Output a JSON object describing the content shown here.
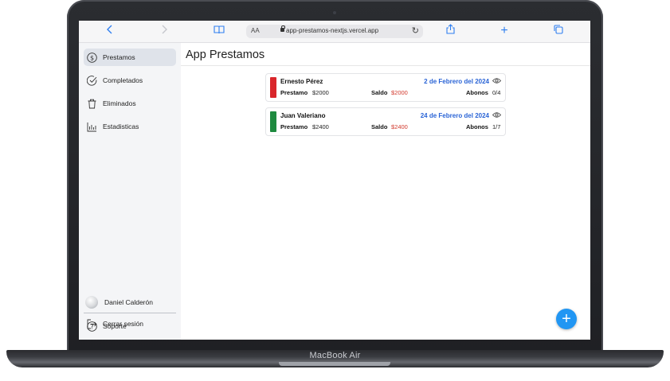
{
  "device": {
    "brand_label": "MacBook Air"
  },
  "browser": {
    "text_size_label": "AA",
    "url": "app-prestamos-nextjs.vercel.app",
    "icons": [
      "back-icon",
      "forward-icon",
      "bookmarks-icon",
      "lock-icon",
      "reload-icon",
      "share-icon",
      "new-tab-icon",
      "tabs-icon"
    ]
  },
  "sidebar": {
    "items": [
      {
        "label": "Prestamos",
        "icon": "dollar-icon",
        "active": true
      },
      {
        "label": "Completados",
        "icon": "check-circle-icon",
        "active": false
      },
      {
        "label": "Eliminados",
        "icon": "trash-icon",
        "active": false
      },
      {
        "label": "Estadisticas",
        "icon": "bar-chart-icon",
        "active": false
      }
    ],
    "user_name": "Daniel Calderón",
    "footer": [
      {
        "label": "Soporte",
        "icon": "help-icon"
      },
      {
        "label": "Cerrar sesión",
        "icon": "logout-icon"
      }
    ]
  },
  "main": {
    "title": "App Prestamos",
    "loans": [
      {
        "name": "Ernesto Pérez",
        "date": "2 de Febrero del 2024",
        "prestamo_label": "Prestamo",
        "prestamo": "$2000",
        "saldo_label": "Saldo",
        "saldo": "$2000",
        "abonos_label": "Abonos",
        "abonos": "0/4",
        "status_color": "#d9262b"
      },
      {
        "name": "Juan Valeriano",
        "date": "24 de Febrero del 2024",
        "prestamo_label": "Prestamo",
        "prestamo": "$2400",
        "saldo_label": "Saldo",
        "saldo": "$2400",
        "abonos_label": "Abonos",
        "abonos": "1/7",
        "status_color": "#1e8a3f"
      }
    ],
    "fab_label": "+"
  },
  "colors": {
    "accent": "#2196f3",
    "date": "#2a64d6",
    "saldo": "#d23a2e",
    "active_nav": "#dfe3ea"
  }
}
